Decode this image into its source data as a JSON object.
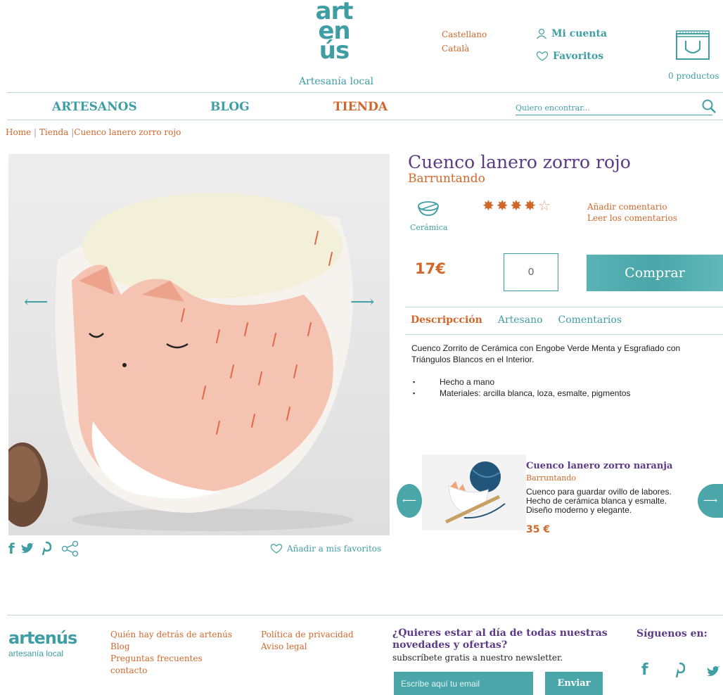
{
  "header": {
    "logo_lines": [
      "art",
      "en",
      "ús"
    ],
    "logo_tagline": "Artesanía local",
    "languages": [
      "Castellano",
      "Català"
    ],
    "account_label": "Mi cuenta",
    "favorites_label": "Favoritos",
    "cart_count": "0 productos"
  },
  "nav": {
    "items": [
      "ARTESANOS",
      "BLOG",
      "TIENDA"
    ],
    "search_placeholder": "Quiero encontrar..."
  },
  "breadcrumb": {
    "home": "Home",
    "sep1": "|",
    "tienda": "Tienda",
    "sep2": "|",
    "current": "Cuenco lanero zorro rojo"
  },
  "product": {
    "title": "Cuenco lanero zorro rojo",
    "artisan": "Barruntando",
    "category": "Cerámica",
    "rating": 4,
    "rating_max": 5,
    "add_comment": "Añadir comentario",
    "read_comments": "Leer los comentarios",
    "price": "17€",
    "quantity": "0",
    "buy_label": "Comprar",
    "add_favorite": "Añadir a mis favoritos"
  },
  "tabs": [
    "Descripcción",
    "Artesano",
    "Comentarios"
  ],
  "description": {
    "text": "Cuenco Zorrito de Cerámica con Engobe Verde Menta y Esgrafiado con Triángulos Blancos en el Interior.",
    "bullets": [
      "Hecho a mano",
      "Materiales: arcilla blanca, loza, esmalte, pigmentos"
    ]
  },
  "related": {
    "title": "Cuenco lanero zorro naranja",
    "artisan": "Barruntando",
    "description": "Cuenco para guardar ovillo de labores. Hecho de cerámica blanca y esmalte. Diseño moderno y elegante.",
    "price": "35 €"
  },
  "footer": {
    "logo": "artenús",
    "logo_sub": "artesanía local",
    "links_col1": [
      "Quién hay detrás de artenús",
      "Blog",
      "Preguntas frecuentes",
      "contacto"
    ],
    "links_col2": [
      "Política de privacidad",
      "Aviso legal"
    ],
    "newsletter_title": "¿Quieres estar al día de todas nuestras novedades y ofertas?",
    "newsletter_sub": "subscríbete gratis a nuestro newsletter.",
    "email_placeholder": "Escribe aquí tu email",
    "send_label": "Enviar",
    "follow_label": "Síguenos en:"
  },
  "colors": {
    "teal": "#3f9ea3",
    "orange": "#d0682c",
    "purple": "#5b3a86"
  }
}
